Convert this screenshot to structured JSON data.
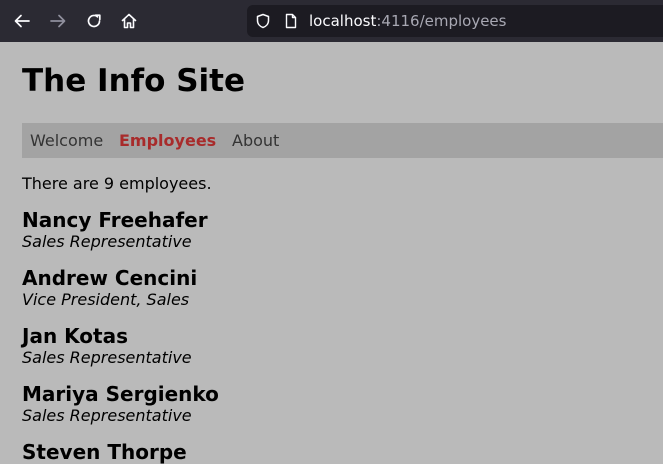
{
  "browser": {
    "url_host": "localhost",
    "url_path": ":4116/employees"
  },
  "site": {
    "title": "The Info Site",
    "nav": [
      {
        "label": "Welcome",
        "active": false
      },
      {
        "label": "Employees",
        "active": true
      },
      {
        "label": "About",
        "active": false
      }
    ],
    "active_color": "#a82b2b"
  },
  "main": {
    "count_text": "There are 9 employees.",
    "employees": [
      {
        "name": "Nancy Freehafer",
        "title": "Sales Representative"
      },
      {
        "name": "Andrew Cencini",
        "title": "Vice President, Sales"
      },
      {
        "name": "Jan Kotas",
        "title": "Sales Representative"
      },
      {
        "name": "Mariya Sergienko",
        "title": "Sales Representative"
      },
      {
        "name": "Steven Thorpe",
        "title": ""
      }
    ]
  }
}
